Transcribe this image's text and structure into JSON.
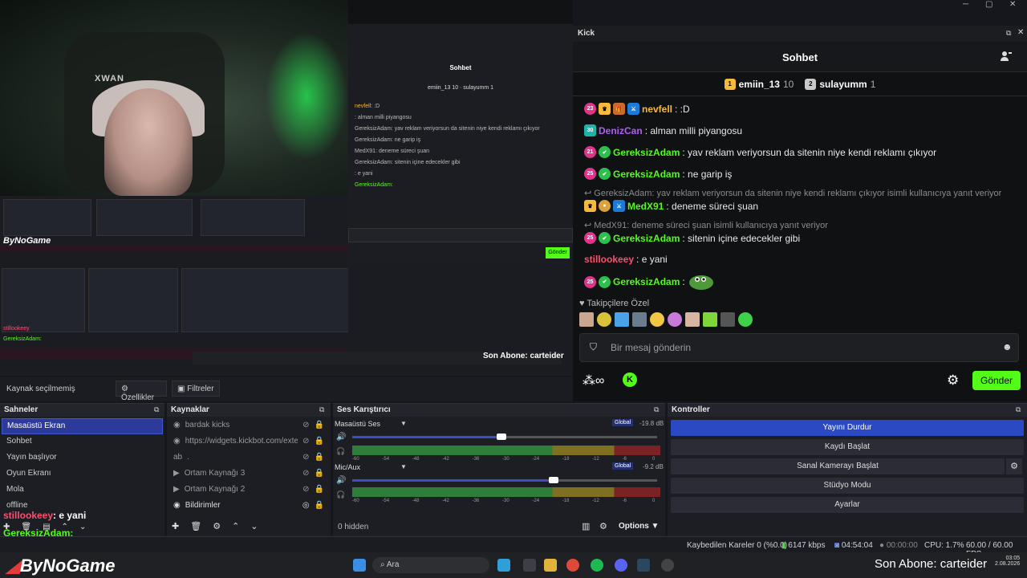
{
  "kick": {
    "window_title": "Kick",
    "chat_title": "Sohbet",
    "gifters": [
      {
        "rank": "1",
        "name": "emiin_13",
        "count": "10",
        "color": "#f6b93b"
      },
      {
        "rank": "2",
        "name": "sulayumm",
        "count": "1",
        "color": "#c9c9c9"
      }
    ],
    "messages": [
      {
        "badge": "23",
        "name": "nevfell",
        "color": "#f6b93b",
        "text": ": :D"
      },
      {
        "badge": "30",
        "name": "DenizCan",
        "color": "#b05bff",
        "text": ": alman milli piyangosu"
      },
      {
        "badge": "21",
        "name": "GereksizAdam",
        "color": "#53fc18",
        "text": ": yav reklam veriyorsun da sitenin niye kendi reklamı çıkıyor"
      },
      {
        "badge": "25",
        "name": "GereksizAdam",
        "color": "#53fc18",
        "text": ": ne garip iş"
      },
      {
        "reply": "GereksizAdam: yav reklam veriyorsun da sitenin niye kendi reklamı çıkıyor isimli kullanıcıya yanıt veriyor"
      },
      {
        "badge": "",
        "name": "MedX91",
        "color": "#53fc18",
        "text": ": deneme süreci şuan"
      },
      {
        "reply": "MedX91: deneme süreci şuan isimli kullanıcıya yanıt veriyor"
      },
      {
        "badge": "25",
        "name": "GereksizAdam",
        "color": "#53fc18",
        "text": ": sitenin içine edecekler gibi"
      },
      {
        "badge": "",
        "name": "stillookeey",
        "color": "#ff4d6d",
        "text": ": e yani"
      },
      {
        "badge": "25",
        "name": "GereksizAdam",
        "color": "#53fc18",
        "text": ":"
      }
    ],
    "emote_section": "Takipçilere Özel",
    "input_placeholder": "Bir mesaj gönderin",
    "send_label": "Gönder"
  },
  "obs": {
    "source_status": "Kaynak seçilmemiş",
    "properties": "Özellikler",
    "filters": "Filtreler",
    "scenes_title": "Sahneler",
    "scenes": [
      "Masaüstü Ekran",
      "Sohbet",
      "Yayın başlıyor",
      "Oyun Ekranı",
      "Mola",
      "offline"
    ],
    "sources_title": "Kaynaklar",
    "sources": [
      "bardak kicks",
      "https://widgets.kickbot.com/exte",
      ".",
      "Ortam Kaynağı 3",
      "Ortam Kaynağı 2",
      "Bildirimler"
    ],
    "mixer_title": "Ses Karıştırıcı",
    "mixer": [
      {
        "name": "Masaüstü Ses",
        "badge": "Global",
        "db": "-19.8 dB",
        "level": 0.49
      },
      {
        "name": "Mic/Aux",
        "badge": "Global",
        "db": "-9.2 dB",
        "level": 0.66
      }
    ],
    "scale": [
      "-60",
      "-54",
      "-48",
      "-42",
      "-36",
      "-30",
      "-24",
      "-18",
      "-12",
      "-6",
      "0"
    ],
    "hidden": "0 hidden",
    "options": "Options",
    "controls_title": "Kontroller",
    "controls": [
      "Yayını Durdur",
      "Kaydı Başlat",
      "Sanal Kamerayı Başlat",
      "Stüdyo Modu",
      "Ayarlar"
    ],
    "status": {
      "dropped": "Kaybedilen Kareler 0 (%0.0)",
      "kbps": "6147 kbps",
      "live": "04:54:04",
      "rec": "00:00:00",
      "cpu": "CPU: 1.7%",
      "fps": "60.00 / 60.00 FPS"
    }
  },
  "overlay": {
    "brand": "ByNoGame",
    "chat1_name": "stillookeey",
    "chat1_text": ": e yani",
    "chat2_name": "GereksizAdam:",
    "last_sub": "Son Abone: carteider"
  },
  "taskbar": {
    "search": "Ara",
    "time": "03:05",
    "date": "2.08.2026"
  }
}
